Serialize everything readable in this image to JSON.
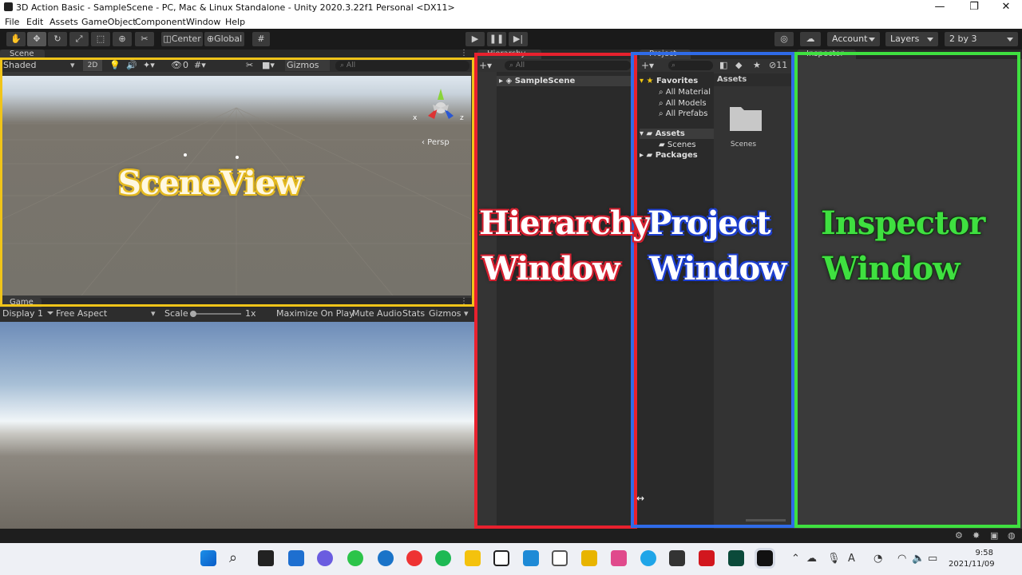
{
  "window": {
    "title": "3D Action Basic - SampleScene - PC, Mac & Linux Standalone - Unity 2020.3.22f1 Personal <DX11>",
    "controls": [
      "—",
      "❐",
      "✕"
    ]
  },
  "menu": [
    "File",
    "Edit",
    "Assets",
    "GameObject",
    "Component",
    "Window",
    "Help"
  ],
  "toolbar": {
    "tools": [
      "hand-tool",
      "move-tool",
      "rotate-tool",
      "scale-tool",
      "rect-tool",
      "transform-tool",
      "custom-tool"
    ],
    "pivot": "Center",
    "space": "Global",
    "account": "Account",
    "layers": "Layers",
    "layout": "2 by 3"
  },
  "scene": {
    "tab": "Scene",
    "shading": "Shaded",
    "mode2d": "2D",
    "hidden_count": "0",
    "gizmos": "Gizmos",
    "search_placeholder": "All",
    "persp": "‹ Persp",
    "axis_x": "x",
    "axis_z": "z"
  },
  "game": {
    "tab": "Game",
    "display": "Display 1",
    "aspect": "Free Aspect",
    "scale_label": "Scale",
    "scale_value": "1x",
    "options": [
      "Maximize On Play",
      "Mute Audio",
      "Stats",
      "Gizmos"
    ]
  },
  "hierarchy": {
    "tab": "Hierarchy",
    "search_placeholder": "All",
    "scene": "SampleScene"
  },
  "project": {
    "tab": "Project",
    "count": "11",
    "favorites": "Favorites",
    "fav_items": [
      "All Material",
      "All Models",
      "All Prefabs"
    ],
    "assets": "Assets",
    "asset_items": [
      "Scenes"
    ],
    "packages": "Packages",
    "breadcrumb": "Assets",
    "folder": "Scenes"
  },
  "inspector": {
    "tab": "Inspector"
  },
  "annotations": {
    "scene": "SceneView",
    "hierarchy_1": "Hierarchy",
    "hierarchy_2": "Window",
    "project_1": "Project",
    "project_2": "Window",
    "inspector_1": "Inspector",
    "inspector_2": "Window"
  },
  "colors": {
    "scene_frame": "#f0c419",
    "hierarchy_frame": "#e8212e",
    "project_frame": "#2f6be8",
    "inspector_frame": "#3fe040"
  },
  "taskbar": {
    "time": "9:58",
    "date": "2021/11/09",
    "ime": "A"
  }
}
